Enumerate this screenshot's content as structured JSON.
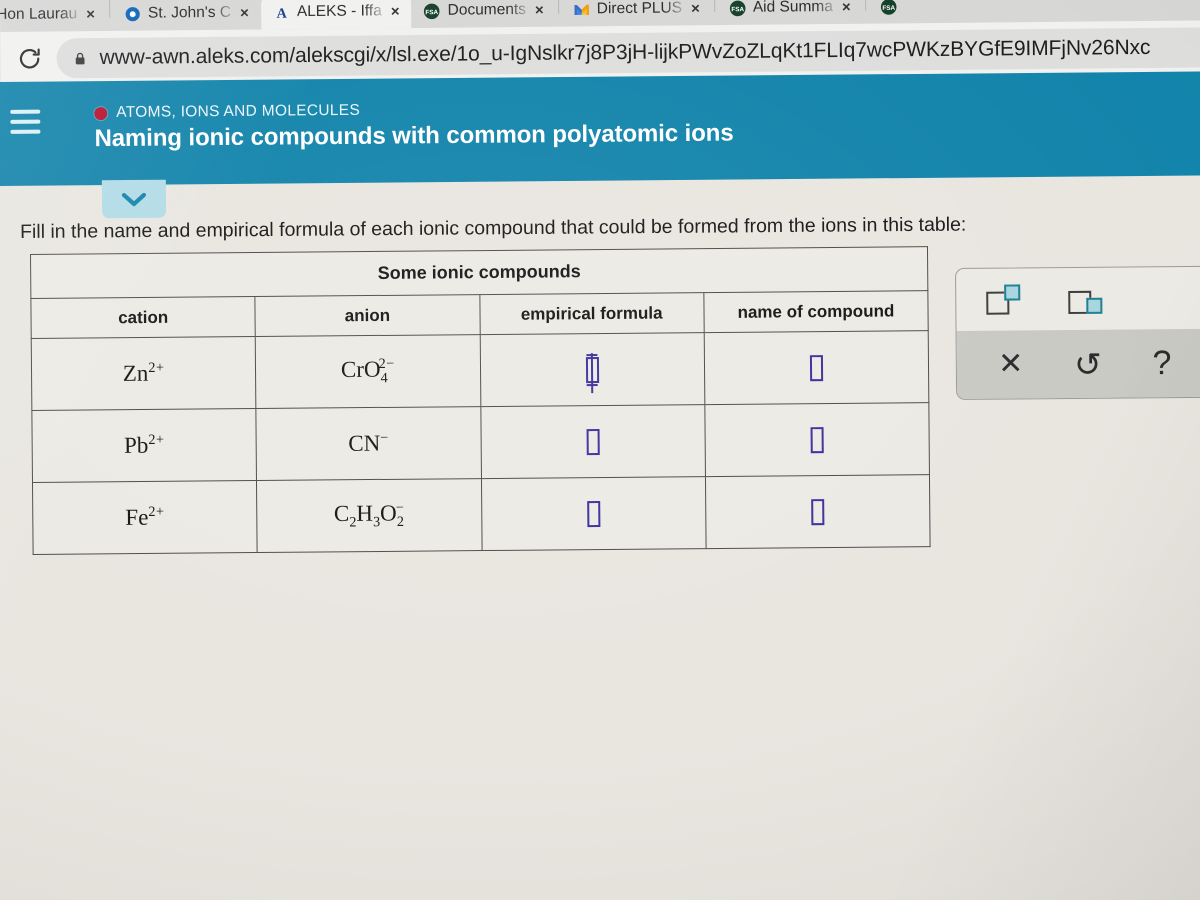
{
  "browser": {
    "tabs": [
      {
        "label": "Hon Laurau",
        "favicon": "youtube-icon",
        "active": false,
        "close_label": "×"
      },
      {
        "label": "St. John's C",
        "favicon": "circle-blue-icon",
        "active": false,
        "close_label": "×"
      },
      {
        "label": "ALEKS - Iffa",
        "favicon": "aleks-a-icon",
        "active": true,
        "close_label": "×"
      },
      {
        "label": "Documents",
        "favicon": "fsa-seal-icon",
        "active": false,
        "close_label": "×"
      },
      {
        "label": "Direct PLUS",
        "favicon": "gmail-m-icon",
        "active": false,
        "close_label": "×"
      },
      {
        "label": "Aid Summa",
        "favicon": "fsa-seal-icon",
        "active": false,
        "close_label": "×"
      },
      {
        "label": "",
        "favicon": "fsa-seal-icon",
        "active": false,
        "close_label": ""
      }
    ],
    "reload_icon": "reload-icon",
    "lock_icon": "lock-icon",
    "url": "www-awn.aleks.com/alekscgi/x/lsl.exe/1o_u-IgNslkr7j8P3jH-lijkPWvZoZLqKt1FLIq7wcPWKzBYGfE9IMFjNv26Nxc"
  },
  "aleks_header": {
    "menu_icon": "hamburger-menu-icon",
    "topic_dot_color": "#b8132f",
    "topic": "ATOMS, IONS AND MOLECULES",
    "title": "Naming ionic compounds with common polyatomic ions",
    "background_color": "#1384ab",
    "collapse_icon": "chevron-down-icon"
  },
  "question": {
    "instruction": "Fill in the name and empirical formula of each ionic compound that could be formed from the ions in this table:",
    "table": {
      "caption": "Some ionic compounds",
      "columns": [
        "cation",
        "anion",
        "empirical formula",
        "name of compound"
      ],
      "rows": [
        {
          "cation": {
            "symbol": "Zn",
            "charge": "2+"
          },
          "anion": {
            "formula": "CrO",
            "subscript": "4",
            "charge": "2−"
          },
          "empirical_formula": "",
          "name_of_compound": ""
        },
        {
          "cation": {
            "symbol": "Pb",
            "charge": "2+"
          },
          "anion": {
            "formula": "CN",
            "subscript": "",
            "charge": "−"
          },
          "empirical_formula": "",
          "name_of_compound": ""
        },
        {
          "cation": {
            "symbol": "Fe",
            "charge": "2+"
          },
          "anion": {
            "formula": "C2H3O2",
            "subscript": "",
            "charge": "−"
          },
          "empirical_formula": "",
          "name_of_compound": ""
        }
      ]
    }
  },
  "tool_palette": {
    "superscript_icon": "superscript-icon",
    "subscript_icon": "subscript-icon",
    "clear_label": "✕",
    "undo_label": "↺",
    "help_label": "?",
    "accent_color": "#1f7f94"
  }
}
